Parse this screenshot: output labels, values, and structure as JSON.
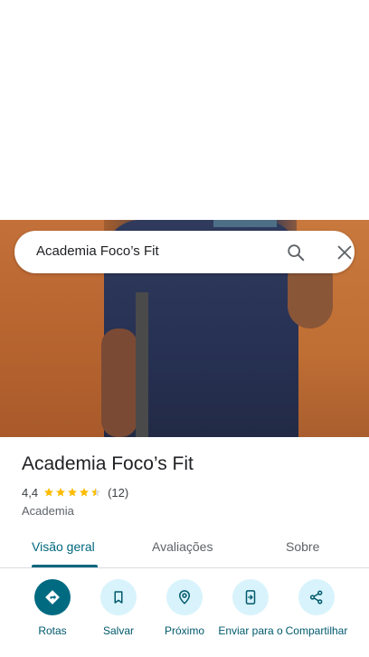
{
  "search": {
    "query": "Academia Foco’s Fit",
    "search_icon": "search-icon",
    "close_icon": "close-icon"
  },
  "place": {
    "title": "Academia Foco’s Fit",
    "rating": "4,4",
    "stars": 4.5,
    "review_count": "(12)",
    "category": "Academia"
  },
  "tabs": [
    {
      "label": "Visão geral",
      "active": true
    },
    {
      "label": "Avaliações",
      "active": false
    },
    {
      "label": "Sobre",
      "active": false
    }
  ],
  "actions": [
    {
      "label": "Rotas",
      "icon": "directions-icon"
    },
    {
      "label": "Salvar",
      "icon": "bookmark-icon"
    },
    {
      "label": "Próximo",
      "icon": "nearby-icon"
    },
    {
      "label": "Enviar para o",
      "icon": "send-to-phone-icon"
    },
    {
      "label": "Compartilhar",
      "icon": "share-icon"
    }
  ],
  "colors": {
    "accent": "#00677d",
    "star": "#fbbc04",
    "action_bg": "#d8f3fb",
    "primary_action": "#006a81"
  }
}
